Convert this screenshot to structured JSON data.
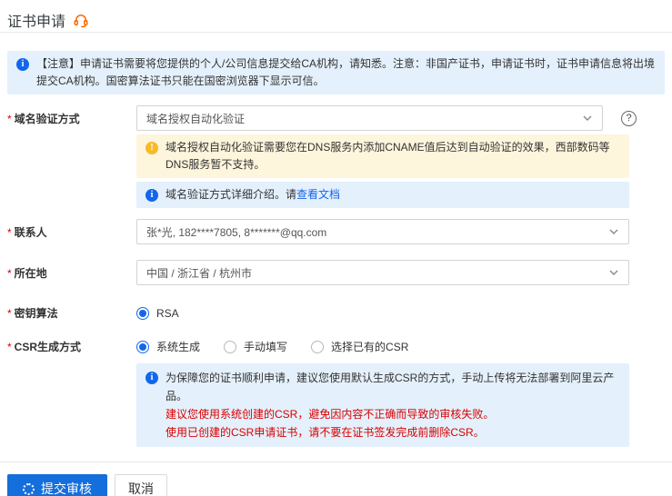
{
  "page": {
    "title": "证书申请",
    "accent_blue": "#1366ec",
    "accent_orange": "#ff6a00",
    "warning_yellow": "#f7ba2a",
    "alert_red": "#d90000"
  },
  "notice": {
    "text": "【注意】申请证书需要将您提供的个人/公司信息提交给CA机构，请知悉。注意：非国产证书，申请证书时，证书申请信息将出境提交CA机构。国密算法证书只能在国密浏览器下显示可信。"
  },
  "form": {
    "required_marker": "*",
    "domain_validation": {
      "label": "域名验证方式",
      "value": "域名授权自动化验证",
      "warning": "域名授权自动化验证需要您在DNS服务内添加CNAME值后达到自动验证的效果，西部数码等DNS服务暂不支持。",
      "info_text": "域名验证方式详细介绍。请",
      "info_link": "查看文档"
    },
    "contact": {
      "label": "联系人",
      "value": "张*光, 182****7805, 8*******@qq.com"
    },
    "location": {
      "label": "所在地",
      "value": "中国 / 浙江省 / 杭州市"
    },
    "key_algorithm": {
      "label": "密钥算法",
      "options": [
        {
          "label": "RSA",
          "selected": true
        }
      ]
    },
    "csr_method": {
      "label": "CSR生成方式",
      "options": [
        {
          "label": "系统生成",
          "selected": true
        },
        {
          "label": "手动填写",
          "selected": false
        },
        {
          "label": "选择已有的CSR",
          "selected": false
        }
      ],
      "info_lines": [
        "为保障您的证书顺利申请，建议您使用默认生成CSR的方式，手动上传将无法部署到阿里云产品。",
        "建议您使用系统创建的CSR，避免因内容不正确而导致的审核失败。",
        "使用已创建的CSR申请证书，请不要在证书签发完成前删除CSR。"
      ]
    }
  },
  "footer": {
    "submit_label": "提交审核",
    "cancel_label": "取消"
  }
}
